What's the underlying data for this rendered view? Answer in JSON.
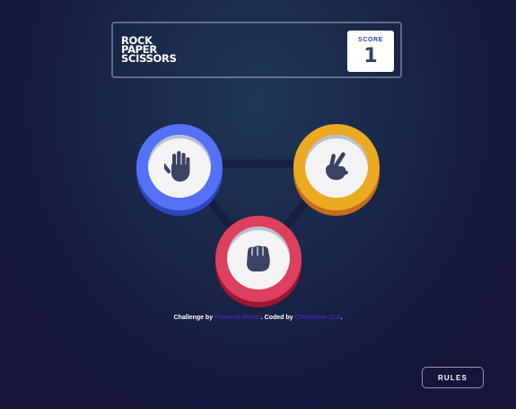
{
  "header": {
    "title_lines": [
      "ROCK",
      "PAPER",
      "SCISSORS"
    ],
    "score_label": "SCORE",
    "score_value": "1"
  },
  "tokens": [
    {
      "name": "paper",
      "color": "#5671f5",
      "icon": "paper-hand-icon"
    },
    {
      "name": "scissors",
      "color": "#eca922",
      "icon": "scissors-hand-icon"
    },
    {
      "name": "rock",
      "color": "#dd405d",
      "icon": "rock-fist-icon"
    }
  ],
  "attribution": {
    "prefix": "Challenge by ",
    "challenge_link": "Frontend Mentor",
    "middle": ". Coded by ",
    "coder_link": "Christopher Doe",
    "suffix": "."
  },
  "rules_button": {
    "label": "RULES"
  },
  "colors": {
    "background_dark": "#141539",
    "background_light": "#1f3756",
    "paper": "#5671f5",
    "scissors": "#eca922",
    "rock": "#dd405d",
    "score_text": "#3b4363",
    "link": "#4b2bd6"
  }
}
